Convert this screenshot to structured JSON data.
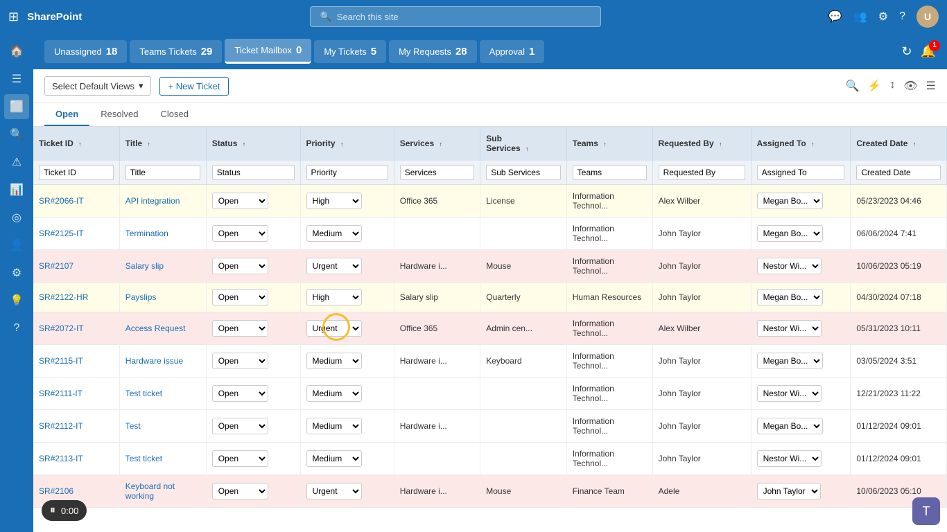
{
  "app": {
    "name": "SharePoint",
    "search_placeholder": "Search this site"
  },
  "tabs": [
    {
      "label": "Unassigned",
      "count": "18",
      "active": false
    },
    {
      "label": "Teams Tickets",
      "count": "29",
      "active": false
    },
    {
      "label": "Ticket Mailbox",
      "count": "0",
      "active": true
    },
    {
      "label": "My Tickets",
      "count": "5",
      "active": false
    },
    {
      "label": "My Requests",
      "count": "28",
      "active": false
    },
    {
      "label": "Approval",
      "count": "1",
      "active": false
    }
  ],
  "toolbar": {
    "view_label": "Select Default Views",
    "new_ticket_label": "+ New Ticket"
  },
  "status_tabs": [
    "Open",
    "Resolved",
    "Closed"
  ],
  "active_status_tab": "Open",
  "columns": [
    {
      "label": "Ticket ID",
      "sort": true
    },
    {
      "label": "Title",
      "sort": true
    },
    {
      "label": "Status",
      "sort": true
    },
    {
      "label": "Priority",
      "sort": true
    },
    {
      "label": "Services",
      "sort": true
    },
    {
      "label": "Sub Services",
      "sort": true
    },
    {
      "label": "Teams",
      "sort": true
    },
    {
      "label": "Requested By",
      "sort": true
    },
    {
      "label": "Assigned To",
      "sort": true
    },
    {
      "label": "Created Date",
      "sort": true
    }
  ],
  "filter_row": {
    "ticket_id": "Ticket ID",
    "title": "Title",
    "status": "Status",
    "priority": "Priority",
    "services": "Services",
    "sub_services": "Sub Services",
    "teams": "Teams",
    "requested_by": "Requested By",
    "assigned_to": "Assigned To",
    "created_date": "Created Date"
  },
  "rows": [
    {
      "id": "SR#2066-IT",
      "title": "API integration",
      "status": "Open",
      "priority": "High",
      "services": "Office 365",
      "sub_services": "License",
      "teams": "Information Technol...",
      "requested_by": "Alex Wilber",
      "assigned_to": "Megan Bo...",
      "created_date": "05/23/2023 04:46",
      "row_class": "row-yellow"
    },
    {
      "id": "SR#2125-IT",
      "title": "Termination",
      "status": "Open",
      "priority": "Medium",
      "services": "",
      "sub_services": "",
      "teams": "Information Technol...",
      "requested_by": "John Taylor",
      "assigned_to": "Megan Bo...",
      "created_date": "06/06/2024 7:41",
      "row_class": "row-white"
    },
    {
      "id": "SR#2107",
      "title": "Salary slip",
      "status": "Open",
      "priority": "Urgent",
      "services": "Hardware i...",
      "sub_services": "Mouse",
      "teams": "Information Technol...",
      "requested_by": "John Taylor",
      "assigned_to": "Nestor Wi...",
      "created_date": "10/06/2023 05:19",
      "row_class": "row-pink"
    },
    {
      "id": "SR#2122-HR",
      "title": "Payslips",
      "status": "Open",
      "priority": "High",
      "services": "Salary slip",
      "sub_services": "Quarterly",
      "teams": "Human Resources",
      "requested_by": "John Taylor",
      "assigned_to": "Megan Bo...",
      "created_date": "04/30/2024 07:18",
      "row_class": "row-yellow"
    },
    {
      "id": "SR#2072-IT",
      "title": "Access Request",
      "status": "Open",
      "priority": "Urgent",
      "services": "Office 365",
      "sub_services": "Admin cen...",
      "teams": "Information Technol...",
      "requested_by": "Alex Wilber",
      "assigned_to": "Nestor Wi...",
      "created_date": "05/31/2023 10:11",
      "row_class": "row-pink"
    },
    {
      "id": "SR#2115-IT",
      "title": "Hardware issue",
      "status": "Open",
      "priority": "Medium",
      "services": "Hardware i...",
      "sub_services": "Keyboard",
      "teams": "Information Technol...",
      "requested_by": "John Taylor",
      "assigned_to": "Megan Bo...",
      "created_date": "03/05/2024 3:51",
      "row_class": "row-white"
    },
    {
      "id": "SR#2111-IT",
      "title": "Test ticket",
      "status": "Open",
      "priority": "Medium",
      "services": "",
      "sub_services": "",
      "teams": "Information Technol...",
      "requested_by": "John Taylor",
      "assigned_to": "Nestor Wi...",
      "created_date": "12/21/2023 11:22",
      "row_class": "row-white"
    },
    {
      "id": "SR#2112-IT",
      "title": "Test",
      "status": "Open",
      "priority": "Medium",
      "services": "Hardware i...",
      "sub_services": "",
      "teams": "Information Technol...",
      "requested_by": "John Taylor",
      "assigned_to": "Megan Bo...",
      "created_date": "01/12/2024 09:01",
      "row_class": "row-white"
    },
    {
      "id": "SR#2113-IT",
      "title": "Test ticket",
      "status": "Open",
      "priority": "Medium",
      "services": "",
      "sub_services": "",
      "teams": "Information Technol...",
      "requested_by": "John Taylor",
      "assigned_to": "Nestor Wi...",
      "created_date": "01/12/2024 09:01",
      "row_class": "row-white"
    },
    {
      "id": "SR#2106",
      "title": "Keyboard not working",
      "status": "Open",
      "priority": "Urgent",
      "services": "Hardware i...",
      "sub_services": "Mouse",
      "teams": "Finance Team",
      "requested_by": "Adele",
      "assigned_to": "John Taylor",
      "created_date": "10/06/2023 05:10",
      "row_class": "row-pink"
    }
  ],
  "timer": {
    "time": "0:00"
  },
  "notification_count": "1"
}
